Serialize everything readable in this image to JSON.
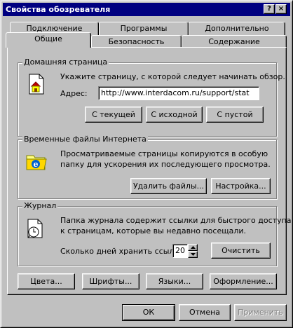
{
  "window": {
    "title": "Свойства обозревателя",
    "help_glyph": "?",
    "close_glyph": "×"
  },
  "tabs": {
    "back_row": [
      "Подключение",
      "Программы",
      "Дополнительно"
    ],
    "front_row": [
      "Общие",
      "Безопасность",
      "Содержание"
    ],
    "active": "Общие"
  },
  "home_page": {
    "group_label": "Домашняя страница",
    "description": "Укажите страницу, с которой следует начинать обзор.",
    "address_label": "Адрес:",
    "address_value": "http://www.interdacom.ru/support/stat",
    "buttons": [
      "С текущей",
      "С исходной",
      "С пустой"
    ]
  },
  "temp_files": {
    "group_label": "Временные файлы Интернета",
    "description_line1": "Просматриваемые страницы копируются в особую",
    "description_line2": "папку для ускорения их последующего просмотра.",
    "buttons": [
      "Удалить файлы...",
      "Настройка..."
    ]
  },
  "history": {
    "group_label": "Журнал",
    "description_line1": "Папка журнала содержит ссылки для быстрого доступа",
    "description_line2": "к страницам, которые вы недавно посещали.",
    "days_label": "Сколько дней хранить ссылки:",
    "days_value": "20",
    "clear_button": "Очистить"
  },
  "bottom_buttons": [
    "Цвета...",
    "Шрифты...",
    "Языки...",
    "Оформление..."
  ],
  "dialog_buttons": {
    "ok": "ОК",
    "cancel": "Отмена",
    "apply": "Применить"
  },
  "icons": {
    "home_page": "home-page-icon",
    "temp_files": "ie-folder-icon",
    "history": "history-icon"
  }
}
